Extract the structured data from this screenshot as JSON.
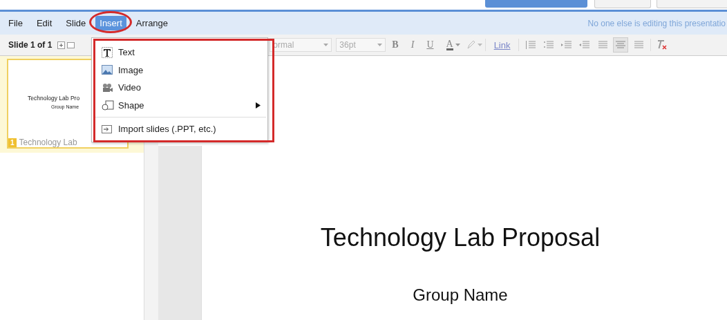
{
  "menu_bar": {
    "items": [
      {
        "label": "File",
        "selected": false
      },
      {
        "label": "Edit",
        "selected": false
      },
      {
        "label": "Slide",
        "selected": false
      },
      {
        "label": "Insert",
        "selected": true
      },
      {
        "label": "Arrange",
        "selected": false
      }
    ],
    "status": "No one else is editing this presentatio"
  },
  "toolbar": {
    "slide_counter": "Slide 1 of 1",
    "style": "ormal",
    "font_size": "36pt",
    "bold": "B",
    "italic": "I",
    "underline": "U",
    "text_color": "A",
    "link": "Link"
  },
  "insert_menu": {
    "items": [
      {
        "kind": "item",
        "label": "Text",
        "has_submenu": false
      },
      {
        "kind": "item",
        "label": "Image",
        "has_submenu": false
      },
      {
        "kind": "item",
        "label": "Video",
        "has_submenu": false
      },
      {
        "kind": "item",
        "label": "Shape",
        "has_submenu": true
      },
      {
        "kind": "separator"
      },
      {
        "kind": "item",
        "label": "Import slides (.PPT, etc.)",
        "has_submenu": false
      }
    ]
  },
  "sidebar": {
    "slides": [
      {
        "title": "Technology Lab Pro",
        "subtitle": "Group Name",
        "number": "1",
        "label": "Technology Lab",
        "selected": true
      }
    ]
  },
  "slide": {
    "title": "Technology Lab Proposal",
    "subtitle": "Group Name"
  }
}
